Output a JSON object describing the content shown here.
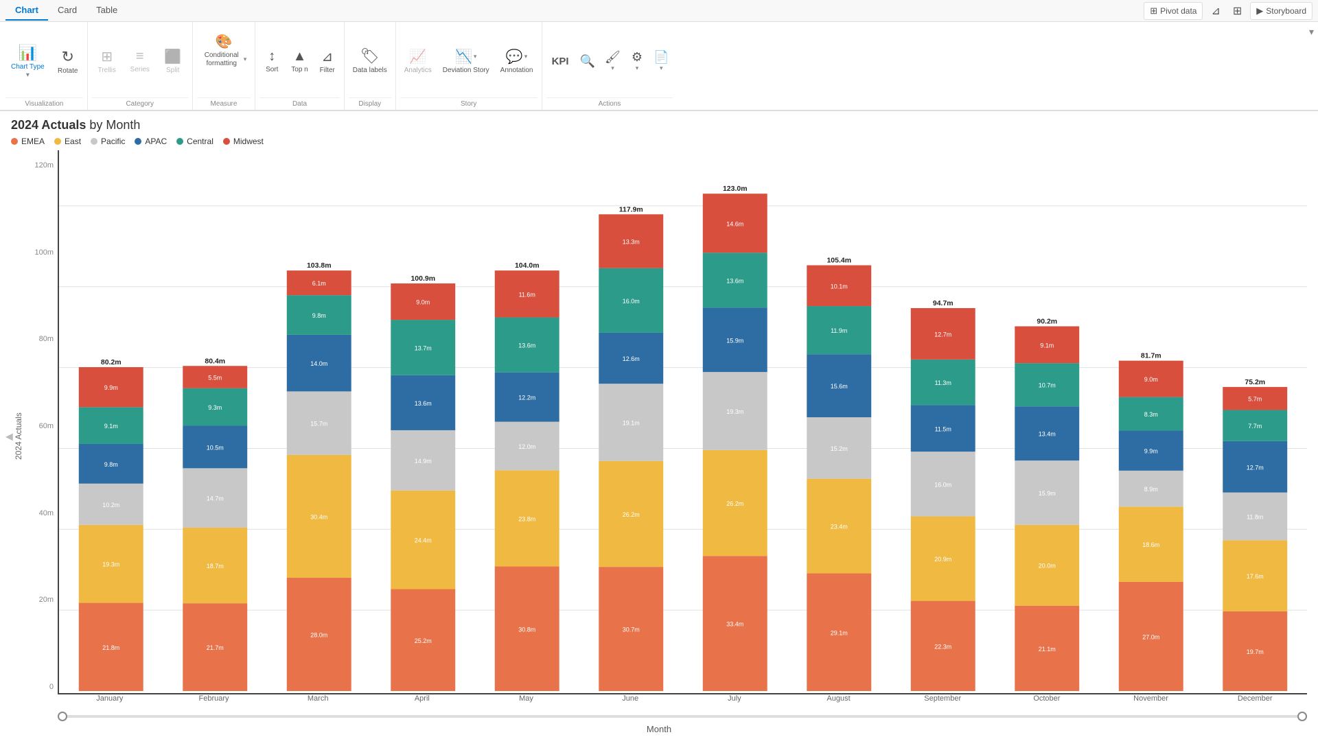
{
  "tabs": {
    "items": [
      "Chart",
      "Card",
      "Table"
    ],
    "active": "Chart"
  },
  "top_right": {
    "pivot_data": "Pivot data",
    "storyboard": "Storyboard"
  },
  "toolbar": {
    "visualization_label": "Visualization",
    "category_label": "Category",
    "measure_label": "Measure",
    "data_label": "Data",
    "display_label": "Display",
    "story_label": "Story",
    "actions_label": "Actions",
    "chart_type_label": "Chart Type",
    "rotate_label": "Rotate",
    "trellis_label": "Trellis",
    "series_label": "Series",
    "split_label": "Split",
    "conditional_label": "Conditional formatting",
    "sort_label": "Sort",
    "topn_label": "Top n",
    "filter_label": "Filter",
    "datalabels_label": "Data labels",
    "analytics_label": "Analytics",
    "deviation_label": "Deviation Story",
    "annotation_label": "Annotation",
    "kpi_label": "KPI",
    "actions_items": [
      "search",
      "brush",
      "gear",
      "pdf"
    ]
  },
  "chart": {
    "title_bold": "2024 Actuals",
    "title_rest": " by Month",
    "y_axis_label": "2024 Actuals",
    "x_axis_label": "Month",
    "y_ticks": [
      "0",
      "20m",
      "40m",
      "60m",
      "80m",
      "100m",
      "120m"
    ],
    "legend": [
      {
        "label": "EMEA",
        "color": "#E8734A"
      },
      {
        "label": "East",
        "color": "#F0B941"
      },
      {
        "label": "Pacific",
        "color": "#C8C8C8"
      },
      {
        "label": "APAC",
        "color": "#2E6DA4"
      },
      {
        "label": "Central",
        "color": "#2D9B8A"
      },
      {
        "label": "Midwest",
        "color": "#D94F3D"
      }
    ],
    "months": [
      "January",
      "February",
      "March",
      "April",
      "May",
      "June",
      "July",
      "August",
      "September",
      "October",
      "November",
      "December"
    ],
    "totals": [
      "80.2m",
      "80.4m",
      "103.8m",
      "100.9m",
      "104.0m",
      "117.9m",
      "123.0m",
      "105.4m",
      "94.7m",
      "90.2m",
      "81.7m",
      "75.2m"
    ],
    "bars": [
      {
        "month": "January",
        "total": "80.2m",
        "segments": [
          {
            "label": "21.8m",
            "value": 21.8,
            "color": "#E8734A"
          },
          {
            "label": "19.3m",
            "value": 19.3,
            "color": "#F0B941"
          },
          {
            "label": "10.2m",
            "value": 10.2,
            "color": "#C8C8C8"
          },
          {
            "label": "9.8m",
            "value": 9.8,
            "color": "#2E6DA4"
          },
          {
            "label": "9.1m",
            "value": 9.1,
            "color": "#2D9B8A"
          },
          {
            "label": "9.9m",
            "value": 9.9,
            "color": "#D94F3D"
          }
        ]
      },
      {
        "month": "February",
        "total": "80.4m",
        "segments": [
          {
            "label": "21.7m",
            "value": 21.7,
            "color": "#E8734A"
          },
          {
            "label": "18.7m",
            "value": 18.7,
            "color": "#F0B941"
          },
          {
            "label": "14.7m",
            "value": 14.7,
            "color": "#C8C8C8"
          },
          {
            "label": "10.5m",
            "value": 10.5,
            "color": "#2E6DA4"
          },
          {
            "label": "9.3m",
            "value": 9.3,
            "color": "#2D9B8A"
          },
          {
            "label": "5.5m",
            "value": 5.5,
            "color": "#D94F3D"
          }
        ]
      },
      {
        "month": "March",
        "total": "103.8m",
        "segments": [
          {
            "label": "28.0m",
            "value": 28.0,
            "color": "#E8734A"
          },
          {
            "label": "30.4m",
            "value": 30.4,
            "color": "#F0B941"
          },
          {
            "label": "15.7m",
            "value": 15.7,
            "color": "#C8C8C8"
          },
          {
            "label": "14.0m",
            "value": 14.0,
            "color": "#2E6DA4"
          },
          {
            "label": "9.8m",
            "value": 9.8,
            "color": "#2D9B8A"
          },
          {
            "label": "6.1m",
            "value": 6.1,
            "color": "#D94F3D"
          }
        ]
      },
      {
        "month": "April",
        "total": "100.9m",
        "segments": [
          {
            "label": "25.2m",
            "value": 25.2,
            "color": "#E8734A"
          },
          {
            "label": "24.4m",
            "value": 24.4,
            "color": "#F0B941"
          },
          {
            "label": "14.9m",
            "value": 14.9,
            "color": "#C8C8C8"
          },
          {
            "label": "13.6m",
            "value": 13.6,
            "color": "#2E6DA4"
          },
          {
            "label": "13.7m",
            "value": 13.7,
            "color": "#2D9B8A"
          },
          {
            "label": "9.0m",
            "value": 9.0,
            "color": "#D94F3D"
          }
        ]
      },
      {
        "month": "May",
        "total": "104.0m",
        "segments": [
          {
            "label": "30.8m",
            "value": 30.8,
            "color": "#E8734A"
          },
          {
            "label": "23.8m",
            "value": 23.8,
            "color": "#F0B941"
          },
          {
            "label": "12.0m",
            "value": 12.0,
            "color": "#C8C8C8"
          },
          {
            "label": "12.2m",
            "value": 12.2,
            "color": "#2E6DA4"
          },
          {
            "label": "13.6m",
            "value": 13.6,
            "color": "#2D9B8A"
          },
          {
            "label": "11.6m",
            "value": 11.6,
            "color": "#D94F3D"
          }
        ]
      },
      {
        "month": "June",
        "total": "117.9m",
        "segments": [
          {
            "label": "30.7m",
            "value": 30.7,
            "color": "#E8734A"
          },
          {
            "label": "26.2m",
            "value": 26.2,
            "color": "#F0B941"
          },
          {
            "label": "19.1m",
            "value": 19.1,
            "color": "#C8C8C8"
          },
          {
            "label": "12.6m",
            "value": 12.6,
            "color": "#2E6DA4"
          },
          {
            "label": "16.0m",
            "value": 16.0,
            "color": "#2D9B8A"
          },
          {
            "label": "13.3m",
            "value": 13.3,
            "color": "#D94F3D"
          }
        ]
      },
      {
        "month": "July",
        "total": "123.0m",
        "segments": [
          {
            "label": "33.4m",
            "value": 33.4,
            "color": "#E8734A"
          },
          {
            "label": "26.2m",
            "value": 26.2,
            "color": "#F0B941"
          },
          {
            "label": "19.3m",
            "value": 19.3,
            "color": "#C8C8C8"
          },
          {
            "label": "15.9m",
            "value": 15.9,
            "color": "#2E6DA4"
          },
          {
            "label": "13.6m",
            "value": 13.6,
            "color": "#2D9B8A"
          },
          {
            "label": "14.6m",
            "value": 14.6,
            "color": "#D94F3D"
          }
        ]
      },
      {
        "month": "August",
        "total": "105.4m",
        "segments": [
          {
            "label": "29.1m",
            "value": 29.1,
            "color": "#E8734A"
          },
          {
            "label": "23.4m",
            "value": 23.4,
            "color": "#F0B941"
          },
          {
            "label": "15.2m",
            "value": 15.2,
            "color": "#C8C8C8"
          },
          {
            "label": "15.6m",
            "value": 15.6,
            "color": "#2E6DA4"
          },
          {
            "label": "11.9m",
            "value": 11.9,
            "color": "#2D9B8A"
          },
          {
            "label": "10.1m",
            "value": 10.1,
            "color": "#D94F3D"
          }
        ]
      },
      {
        "month": "September",
        "total": "94.7m",
        "segments": [
          {
            "label": "22.3m",
            "value": 22.3,
            "color": "#E8734A"
          },
          {
            "label": "20.9m",
            "value": 20.9,
            "color": "#F0B941"
          },
          {
            "label": "16.0m",
            "value": 16.0,
            "color": "#C8C8C8"
          },
          {
            "label": "11.5m",
            "value": 11.5,
            "color": "#2E6DA4"
          },
          {
            "label": "11.3m",
            "value": 11.3,
            "color": "#2D9B8A"
          },
          {
            "label": "12.7m",
            "value": 12.7,
            "color": "#D94F3D"
          }
        ]
      },
      {
        "month": "October",
        "total": "90.2m",
        "segments": [
          {
            "label": "21.1m",
            "value": 21.1,
            "color": "#E8734A"
          },
          {
            "label": "20.0m",
            "value": 20.0,
            "color": "#F0B941"
          },
          {
            "label": "15.9m",
            "value": 15.9,
            "color": "#C8C8C8"
          },
          {
            "label": "13.4m",
            "value": 13.4,
            "color": "#2E6DA4"
          },
          {
            "label": "10.7m",
            "value": 10.7,
            "color": "#2D9B8A"
          },
          {
            "label": "9.1m",
            "value": 9.1,
            "color": "#D94F3D"
          }
        ]
      },
      {
        "month": "November",
        "total": "81.7m",
        "segments": [
          {
            "label": "27.0m",
            "value": 27.0,
            "color": "#E8734A"
          },
          {
            "label": "18.6m",
            "value": 18.6,
            "color": "#F0B941"
          },
          {
            "label": "8.9m",
            "value": 8.9,
            "color": "#C8C8C8"
          },
          {
            "label": "9.9m",
            "value": 9.9,
            "color": "#2E6DA4"
          },
          {
            "label": "8.3m",
            "value": 8.3,
            "color": "#2D9B8A"
          },
          {
            "label": "9.0m",
            "value": 9.0,
            "color": "#D94F3D"
          }
        ]
      },
      {
        "month": "December",
        "total": "75.2m",
        "segments": [
          {
            "label": "19.7m",
            "value": 19.7,
            "color": "#E8734A"
          },
          {
            "label": "17.6m",
            "value": 17.6,
            "color": "#F0B941"
          },
          {
            "label": "11.8m",
            "value": 11.8,
            "color": "#C8C8C8"
          },
          {
            "label": "12.7m",
            "value": 12.7,
            "color": "#2E6DA4"
          },
          {
            "label": "7.7m",
            "value": 7.7,
            "color": "#2D9B8A"
          },
          {
            "label": "5.7m",
            "value": 5.7,
            "color": "#D94F3D"
          }
        ]
      }
    ]
  }
}
